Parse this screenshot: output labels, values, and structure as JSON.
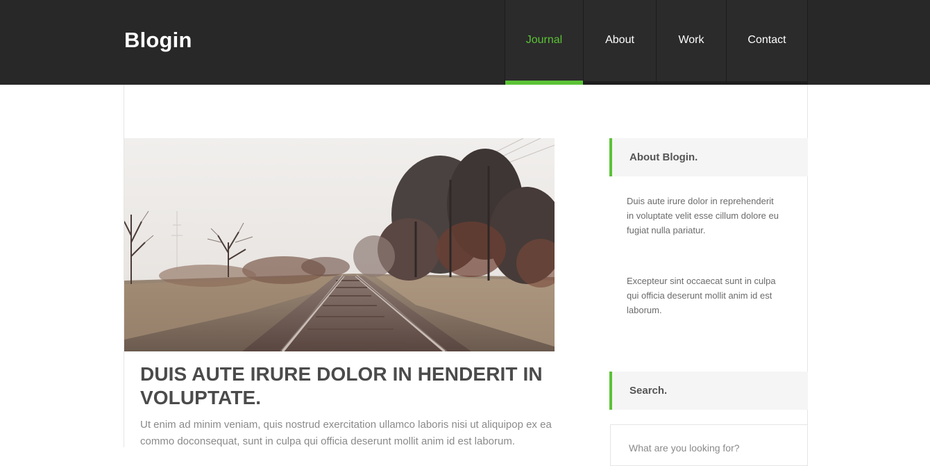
{
  "header": {
    "brand": "Blogin",
    "nav": [
      {
        "label": "Journal",
        "active": true
      },
      {
        "label": "About",
        "active": false
      },
      {
        "label": "Work",
        "active": false
      },
      {
        "label": "Contact",
        "active": false
      }
    ]
  },
  "post": {
    "image": "railway-tracks-photo",
    "title": "DUIS AUTE IRURE DOLOR IN HENDERIT IN VOLUPTATE.",
    "excerpt": "Ut enim ad minim veniam, quis nostrud exercitation ullamco laboris nisi ut aliquipop ex ea commo doconsequat, sunt in culpa qui officia deserunt mollit anim id est laborum."
  },
  "sidebar": {
    "about": {
      "title": "About Blogin.",
      "paragraph1": "Duis aute irure dolor in reprehenderit in voluptate velit esse cillum dolore eu fugiat nulla pariatur.",
      "paragraph2": "Excepteur sint occaecat sunt in culpa qui officia deserunt mollit anim id est laborum."
    },
    "search": {
      "title": "Search.",
      "placeholder": "What are you looking for?"
    }
  },
  "colors": {
    "accent": "#5bc236",
    "header_bg": "#282828"
  }
}
